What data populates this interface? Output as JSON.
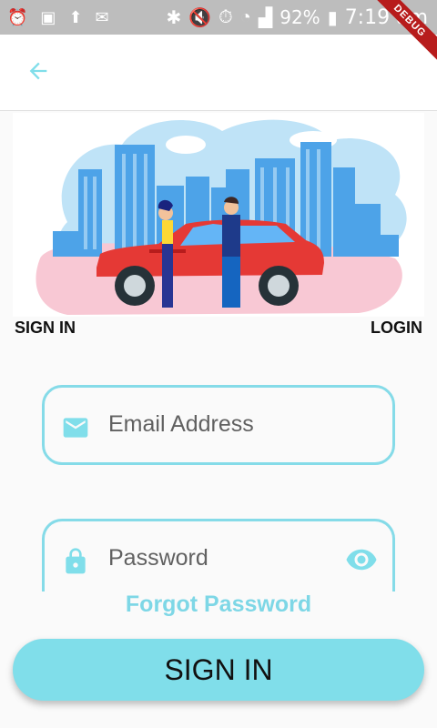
{
  "status_bar": {
    "battery": "92%",
    "time": "7:19 am",
    "debug_banner": "DEBUG"
  },
  "app_bar": {
    "back_icon": "arrow-left-icon"
  },
  "tabs": {
    "left_label": "SIGN IN",
    "right_label": "LOGIN"
  },
  "form": {
    "email_placeholder": "Email Address",
    "password_placeholder": "Password",
    "forgot_label": "Forgot Password",
    "submit_label": "SIGN IN"
  },
  "colors": {
    "accent": "#80deea",
    "field_border": "#85dbe8",
    "status_bar": "#bdbdbd"
  }
}
